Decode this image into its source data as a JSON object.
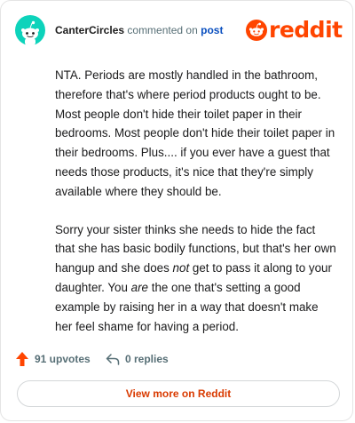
{
  "comment": {
    "username": "CanterCircles",
    "action_text": "commented on",
    "post_link_text": "post",
    "paragraph_1": "NTA. Periods are mostly handled in the bathroom, therefore that's where period products ought to be. Most people don't hide their toilet paper in their bedrooms. Most people don't hide their toilet paper in their bedrooms. Plus.... if you ever have a guest that needs those products, it's nice that they're simply available where they should be.",
    "paragraph_2_part_1": "Sorry your sister thinks she needs to hide the fact that she has basic bodily functions, but that's her own hangup and she does ",
    "paragraph_2_emphasis_1": "not",
    "paragraph_2_part_2": " get to pass it along to your daughter. You ",
    "paragraph_2_emphasis_2": "are",
    "paragraph_2_part_3": " the one that's setting a good example by raising her in a way that doesn't make her feel shame for having a period."
  },
  "brand": {
    "wordmark": "reddit",
    "color": "#ff4500",
    "logo_icon": "reddit-snoo-icon"
  },
  "avatar": {
    "icon": "snoo-avatar-icon",
    "color": "#0dd3bb"
  },
  "stats": {
    "upvotes_label": "91 upvotes",
    "replies_label": "0 replies",
    "upvote_icon": "upvote-arrow-icon",
    "reply_icon": "reply-arrow-icon",
    "upvote_color": "#ff4500"
  },
  "footer": {
    "view_more_label": "View more on Reddit"
  }
}
